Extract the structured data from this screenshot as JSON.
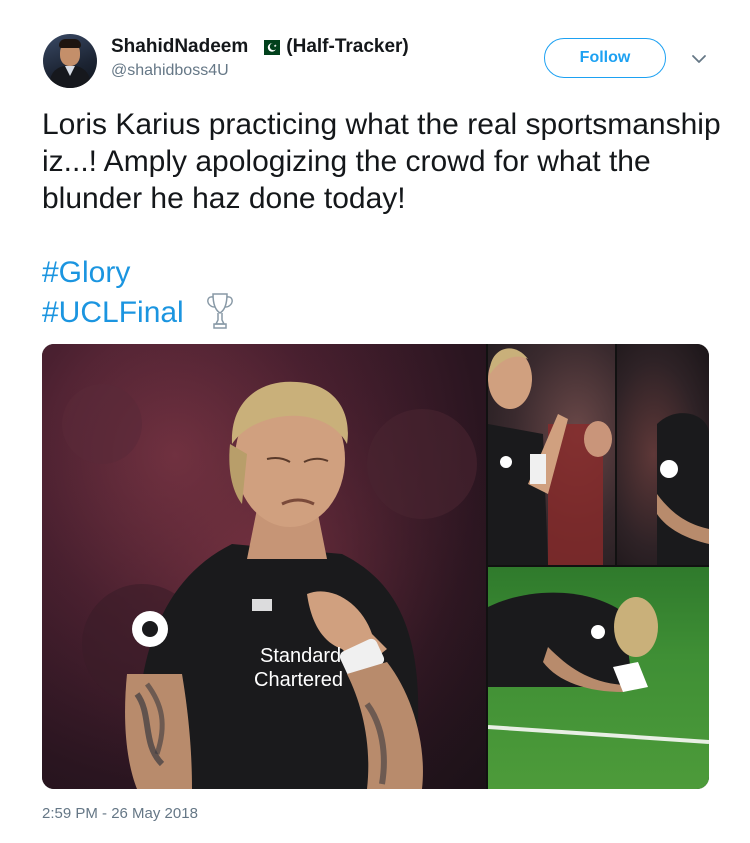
{
  "author": {
    "display_name": "ShahidNadeem",
    "name_suffix": "(Half-Tracker)",
    "handle": "@shahidboss4U",
    "flag_icon": "pakistan-flag-icon"
  },
  "follow_button": {
    "label": "Follow"
  },
  "more_menu_icon": "chevron-down-icon",
  "tweet": {
    "text": "Loris Karius practicing what the real sportsmanship iz...! Amply apologizing the crowd for what the blunder he haz done today!",
    "hashtags": [
      "#Glory",
      "#UCLFinal"
    ],
    "emoji_icon": "trophy-icon"
  },
  "media": {
    "main_photo": {
      "jersey_text": [
        "Standard",
        "Chartered"
      ]
    }
  },
  "timestamp": "2:59 PM - 26 May 2018",
  "colors": {
    "accent": "#1da1f2",
    "hashtag": "#1b95e0",
    "secondary_text": "#657786",
    "primary_text": "#14171a"
  }
}
